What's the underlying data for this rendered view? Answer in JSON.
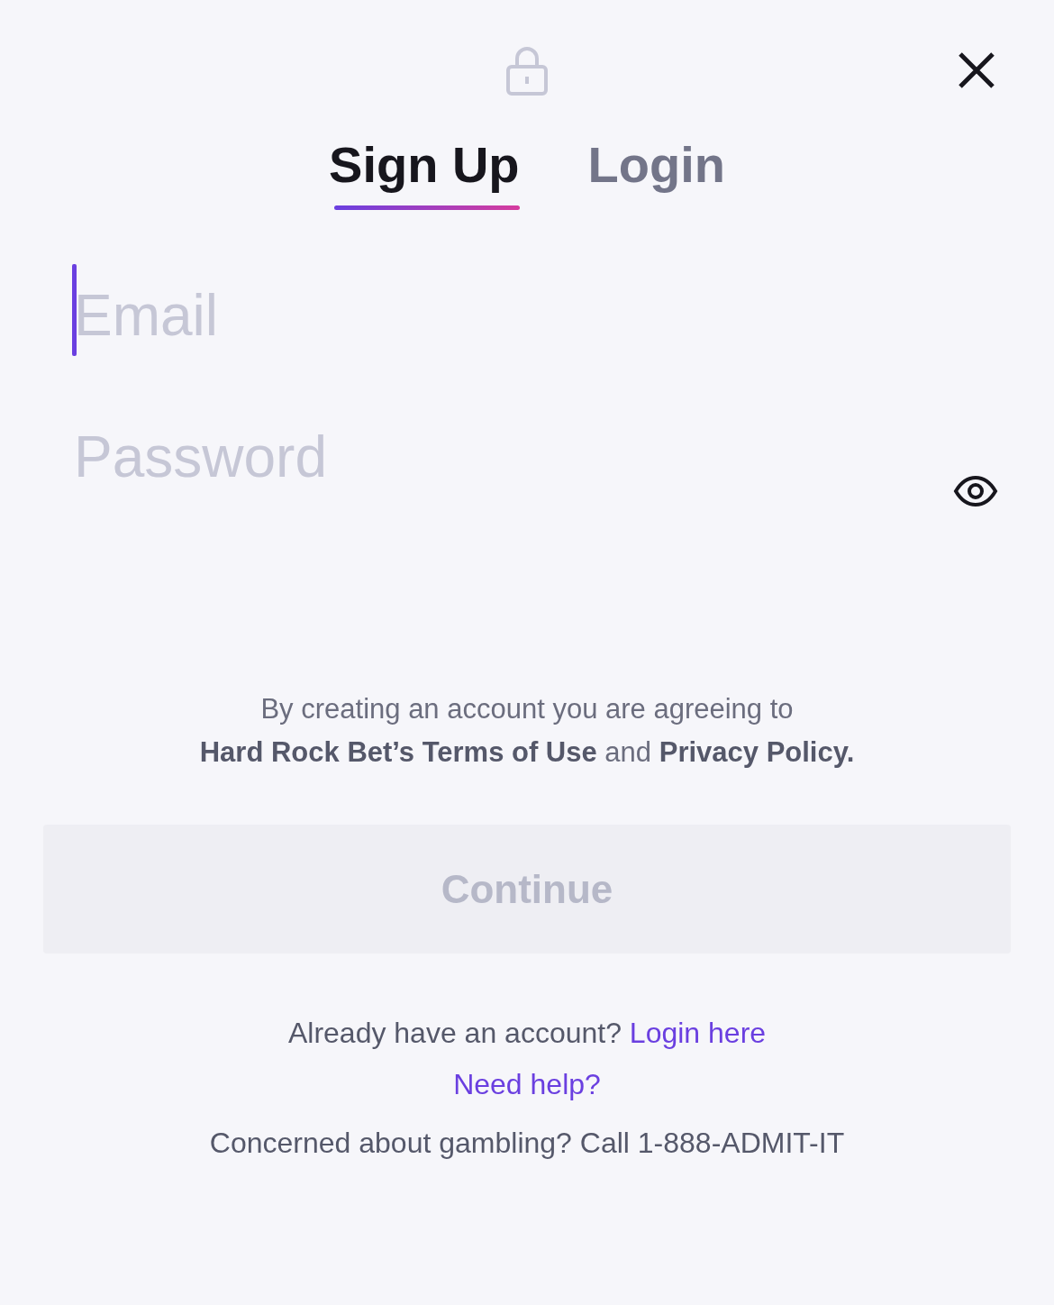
{
  "tabs": [
    {
      "label": "Sign Up",
      "selected": true
    },
    {
      "label": "Login",
      "selected": false
    }
  ],
  "email": {
    "placeholder": "Email",
    "focused": true
  },
  "password": {
    "placeholder": "Password"
  },
  "terms": [
    "By creating an account you are agreeing to",
    "**Hard Rock Bet’s Terms of Use** and **Privacy Policy.**"
  ],
  "continue_button": {
    "label": "Continue",
    "disabled": true
  },
  "footer": {
    "prompt": "Already have an account?",
    "login_link": "Login here",
    "help_link": "Need help?",
    "gambling_notice": "Concerned about gambling? Call 1-888-ADMIT-IT"
  }
}
